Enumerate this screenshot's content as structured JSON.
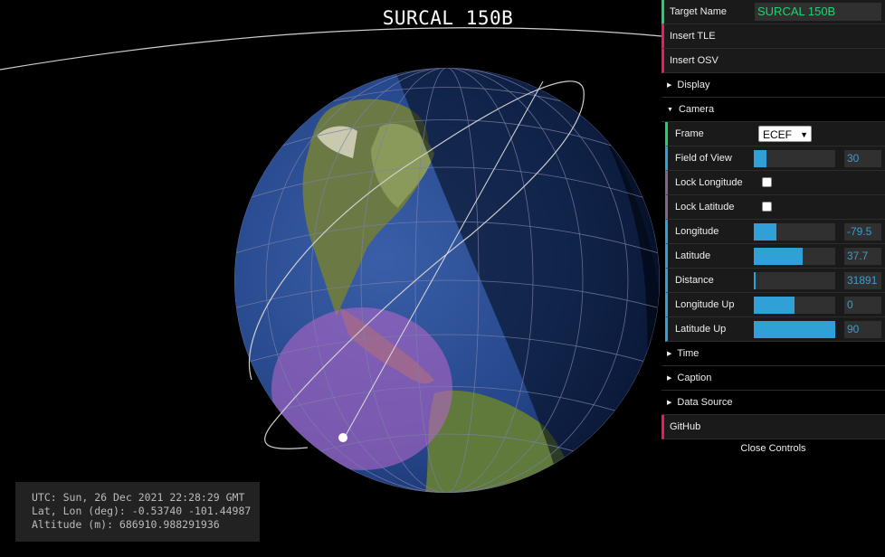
{
  "title": "SURCAL 150B",
  "info": {
    "utc": "UTC: Sun, 26 Dec 2021 22:28:29 GMT",
    "latlon": "Lat, Lon (deg): -0.53740 -101.44987",
    "altitude": "Altitude (m): 686910.988291936"
  },
  "controls": {
    "target_name_label": "Target Name",
    "target_name_value": "SURCAL 150B",
    "insert_tle": "Insert TLE",
    "insert_osv": "Insert OSV",
    "display": "Display",
    "camera": "Camera",
    "frame_label": "Frame",
    "frame_value": "ECEF",
    "fov_label": "Field of View",
    "fov_value": "30",
    "fov_fraction": 0.15,
    "lock_lon_label": "Lock Longitude",
    "lock_lat_label": "Lock Latitude",
    "lon_label": "Longitude",
    "lon_value": "-79.5",
    "lon_fraction": 0.28,
    "lat_label": "Latitude",
    "lat_value": "37.7",
    "lat_fraction": 0.6,
    "dist_label": "Distance",
    "dist_value": "31891",
    "dist_fraction": 0.02,
    "lon_up_label": "Longitude Up",
    "lon_up_value": "0",
    "lon_up_fraction": 0.5,
    "lat_up_label": "Latitude Up",
    "lat_up_value": "90",
    "lat_up_fraction": 1.0,
    "time": "Time",
    "caption": "Caption",
    "data_source": "Data Source",
    "github": "GitHub",
    "close": "Close Controls"
  },
  "colors": {
    "string_accent": "#1ed36f",
    "function_accent": "#e61d5f",
    "number_accent": "#2fa1d6",
    "boolean_accent": "#806787"
  }
}
